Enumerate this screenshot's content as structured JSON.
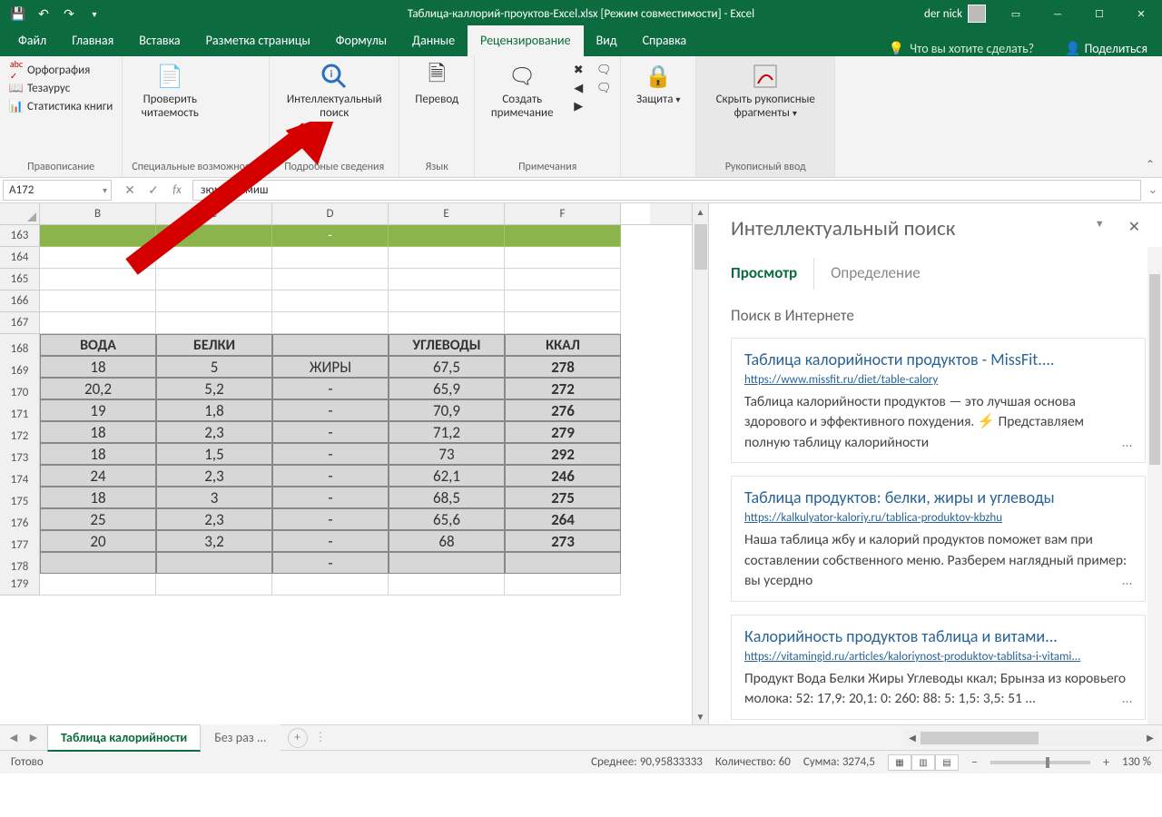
{
  "title": "Таблица-каллорий-проуктов-Excel.xlsx  [Режим совместимости]  -  Excel",
  "user": "der nick",
  "tabs": [
    "Файл",
    "Главная",
    "Вставка",
    "Разметка страницы",
    "Формулы",
    "Данные",
    "Рецензирование",
    "Вид",
    "Справка"
  ],
  "active_tab": 6,
  "tell_me": "Что вы хотите сделать?",
  "share": "Поделиться",
  "ribbon": {
    "g1": {
      "label": "Правописание",
      "items": [
        "Орфография",
        "Тезаурус",
        "Статистика книги"
      ]
    },
    "g2": {
      "label": "Специальные возможности",
      "btn": "Проверить\nчитаемость"
    },
    "g3": {
      "label": "Подробные сведения",
      "btn": "Интеллектуальный\nпоиск"
    },
    "g4": {
      "label": "Язык",
      "btn": "Перевод"
    },
    "g5": {
      "label": "Примечания",
      "btn": "Создать\nпримечание"
    },
    "g6": {
      "label": "",
      "btn": "Защита"
    },
    "g7": {
      "label": "Рукописный ввод",
      "btn": "Скрыть рукописные\nфрагменты"
    }
  },
  "namebox": "A172",
  "formula": "зюм кишмиш",
  "columns": [
    "B",
    "C",
    "D",
    "E",
    "F"
  ],
  "blank_rows": [
    163,
    164,
    165,
    166,
    167
  ],
  "green_dash_col": 2,
  "headers": [
    "ВОДА",
    "БЕЛКИ",
    "",
    "УГЛЕВОДЫ",
    "ККАЛ"
  ],
  "data_rows": [
    {
      "n": 169,
      "v": [
        "18",
        "5",
        "ЖИРЫ",
        "67,5",
        "278"
      ]
    },
    {
      "n": 170,
      "v": [
        "20,2",
        "5,2",
        "-",
        "65,9",
        "272"
      ]
    },
    {
      "n": 171,
      "v": [
        "19",
        "1,8",
        "-",
        "70,9",
        "276"
      ]
    },
    {
      "n": 172,
      "v": [
        "18",
        "2,3",
        "-",
        "71,2",
        "279"
      ]
    },
    {
      "n": 173,
      "v": [
        "18",
        "1,5",
        "-",
        "73",
        "292"
      ]
    },
    {
      "n": 174,
      "v": [
        "24",
        "2,3",
        "-",
        "62,1",
        "246"
      ]
    },
    {
      "n": 175,
      "v": [
        "18",
        "3",
        "-",
        "68,5",
        "275"
      ]
    },
    {
      "n": 176,
      "v": [
        "25",
        "2,3",
        "-",
        "65,6",
        "264"
      ]
    },
    {
      "n": 177,
      "v": [
        "20",
        "3,2",
        "-",
        "68",
        "273"
      ]
    },
    {
      "n": 178,
      "v": [
        "",
        "",
        "-",
        "",
        ""
      ]
    }
  ],
  "trail_row": 179,
  "head_row": 168,
  "sheet_tab_active": "Таблица калорийности",
  "sheet_tab_other": "Без раз ...",
  "panel": {
    "title": "Интеллектуальный поиск",
    "tabs": [
      "Просмотр",
      "Определение"
    ],
    "subtitle": "Поиск в Интернете",
    "results": [
      {
        "title": "Таблица калорийности продуктов - MissFit....",
        "url": "https://www.missfit.ru/diet/table-calory",
        "snip": "Таблица калорийности продуктов — это лучшая основа здорового и эффективного похудения. ⚡ Представляем полную таблицу калорийности"
      },
      {
        "title": "Таблица продуктов: белки, жиры и углеводы",
        "url": "https://kalkulyator-kaloriy.ru/tablica-produktov-kbzhu",
        "snip": "Наша таблица жбу и калорий продуктов поможет вам при составлении собственного меню. Разберем наглядный пример: вы усердно"
      },
      {
        "title": "Калорийность продуктов таблица и витами...",
        "url": "https://vitamingid.ru/articles/kaloriynost-produktov-tablitsa-i-vitami...",
        "snip": "Продукт Вода Белки Жиры Углеводы ккал; Брынза из коровьего молока: 52: 17,9: 20,1: 0: 260: 88: 5: 1,5: 3,5: 51 ..."
      }
    ]
  },
  "status": {
    "ready": "Готово",
    "avg_label": "Среднее:",
    "avg": "90,95833333",
    "count_label": "Количество:",
    "count": "60",
    "sum_label": "Сумма:",
    "sum": "3274,5",
    "zoom": "130 %"
  },
  "chart_data": {
    "type": "table",
    "columns": [
      "ВОДА",
      "БЕЛКИ",
      "ЖИРЫ",
      "УГЛЕВОДЫ",
      "ККАЛ"
    ],
    "rows": [
      [
        18,
        5,
        null,
        67.5,
        278
      ],
      [
        20.2,
        5.2,
        null,
        65.9,
        272
      ],
      [
        19,
        1.8,
        null,
        70.9,
        276
      ],
      [
        18,
        2.3,
        null,
        71.2,
        279
      ],
      [
        18,
        1.5,
        null,
        73,
        292
      ],
      [
        24,
        2.3,
        null,
        62.1,
        246
      ],
      [
        18,
        3,
        null,
        68.5,
        275
      ],
      [
        25,
        2.3,
        null,
        65.6,
        264
      ],
      [
        20,
        3.2,
        null,
        68,
        273
      ]
    ]
  }
}
